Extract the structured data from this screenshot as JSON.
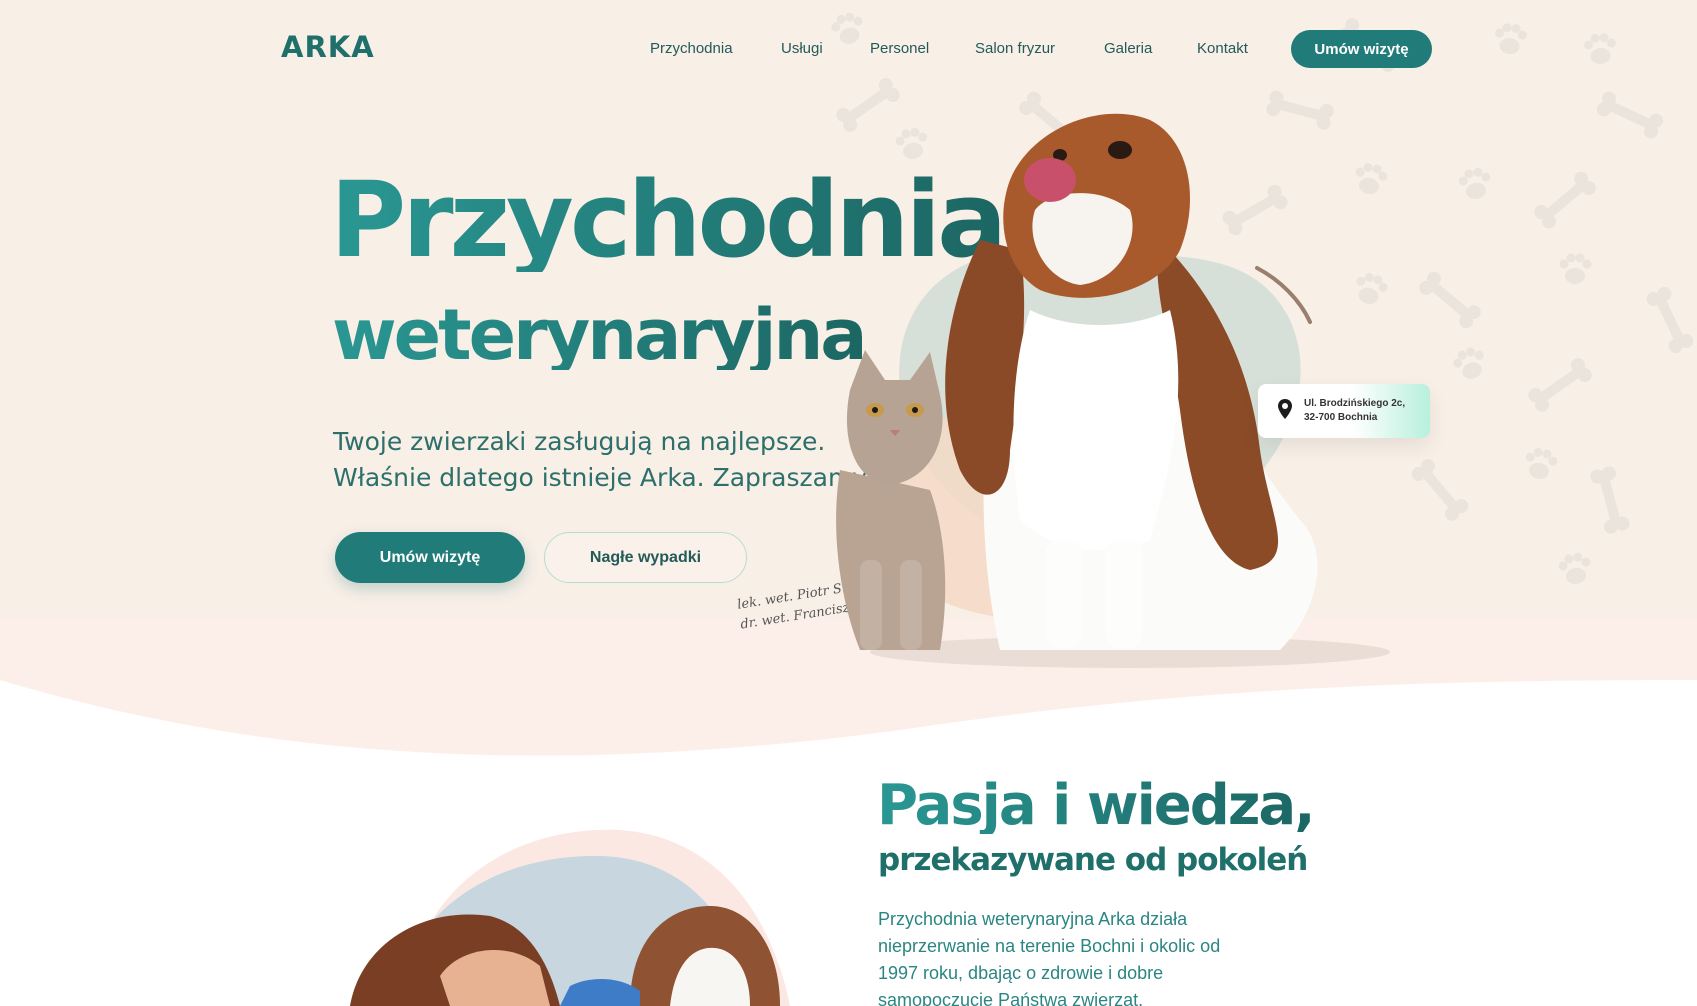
{
  "brand": {
    "logo": "ARKA"
  },
  "nav": {
    "items": [
      "Przychodnia",
      "Usługi",
      "Personel",
      "Salon fryzur",
      "Galeria",
      "Kontakt"
    ],
    "cta": "Umów wizytę"
  },
  "hero": {
    "title": "Przychodnia",
    "subtitle": "weterynaryjna",
    "desc_line1": "Twoje zwierzaki zasługują na najlepsze.",
    "desc_line2": "Właśnie dlatego istnieje Arka. Zapraszamy!",
    "primary_button": "Umów wizytę",
    "secondary_button": "Nagłe wypadki",
    "signature_line1": "lek. wet. Piotr Surma",
    "signature_line2": "dr. wet. Franciszek Surma",
    "address_line1": "Ul. Brodzińskiego 2c,",
    "address_line2": "32-700 Bochnia"
  },
  "section2": {
    "title": "Pasja i wiedza,",
    "subtitle": "przekazywane od pokoleń",
    "text": "Przychodnia weterynaryjna Arka działa nieprzerwanie na terenie Bochni i okolic od 1997 roku, dbając o zdrowie i dobre samopoczucie Państwa zwierząt."
  },
  "icons": {
    "address": "location-pin-icon",
    "pattern": [
      "bone-icon",
      "paw-icon"
    ]
  },
  "colors": {
    "accent": "#217c79",
    "hero_bg": "#f8efe7",
    "text": "#1d6b6b"
  }
}
